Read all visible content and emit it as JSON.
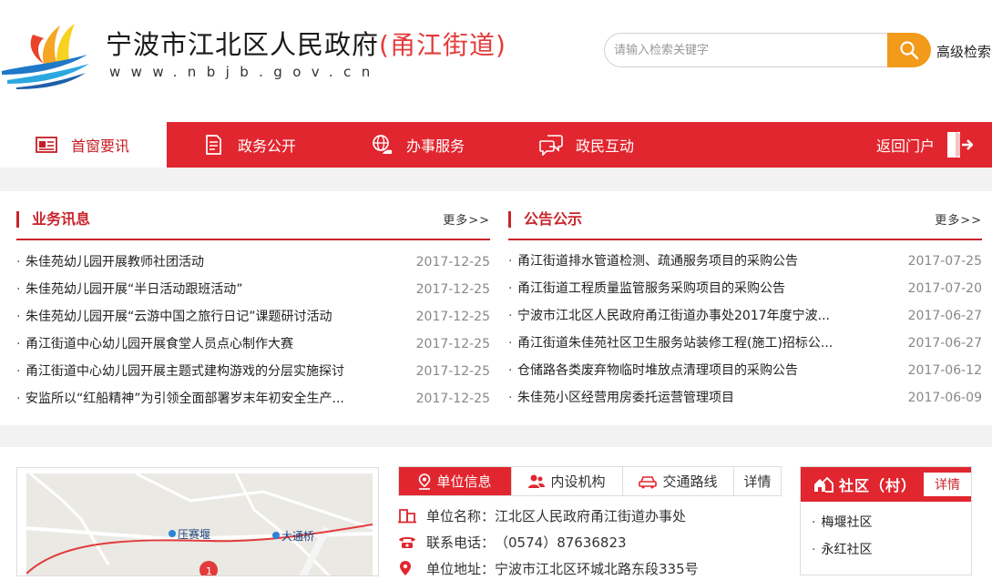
{
  "header": {
    "title_main": "宁波市江北区人民政府",
    "title_sub": "(甬江街道)",
    "url_text": "www.nbjb.gov.cn",
    "search_placeholder": "请输入检索关键字",
    "advanced_search": "高级检索"
  },
  "nav": {
    "items": [
      {
        "label": "首窗要讯",
        "icon": "newspaper-icon"
      },
      {
        "label": "政务公开",
        "icon": "document-icon"
      },
      {
        "label": "办事服务",
        "icon": "globe-hand-icon"
      },
      {
        "label": "政民互动",
        "icon": "chat-bubbles-icon"
      }
    ],
    "back_label": "返回门户"
  },
  "news": {
    "title": "业务讯息",
    "more": "更多>>",
    "items": [
      {
        "text": "朱佳苑幼儿园开展教师社团活动",
        "date": "2017-12-25"
      },
      {
        "text": "朱佳苑幼儿园开展“半日活动跟班活动”",
        "date": "2017-12-25"
      },
      {
        "text": "朱佳苑幼儿园开展“云游中国之旅行日记”课题研讨活动",
        "date": "2017-12-25"
      },
      {
        "text": "甬江街道中心幼儿园开展食堂人员点心制作大赛",
        "date": "2017-12-25"
      },
      {
        "text": "甬江街道中心幼儿园开展主题式建构游戏的分层实施探讨",
        "date": "2017-12-25"
      },
      {
        "text": "安监所以“红船精神”为引领全面部署岁末年初安全生产...",
        "date": "2017-12-25"
      }
    ]
  },
  "notices": {
    "title": "公告公示",
    "more": "更多>>",
    "items": [
      {
        "text": "甬江街道排水管道检测、疏通服务项目的采购公告",
        "date": "2017-07-25"
      },
      {
        "text": "甬江街道工程质量监管服务采购项目的采购公告",
        "date": "2017-07-20"
      },
      {
        "text": "宁波市江北区人民政府甬江街道办事处2017年度宁波...",
        "date": "2017-06-27"
      },
      {
        "text": "甬江街道朱佳苑社区卫生服务站装修工程(施工)招标公...",
        "date": "2017-06-27"
      },
      {
        "text": "仓储路各类废弃物临时堆放点清理项目的采购公告",
        "date": "2017-06-12"
      },
      {
        "text": "朱佳苑小区经营用房委托运营管理项目",
        "date": "2017-06-09"
      }
    ]
  },
  "map": {
    "labels": [
      "压赛堰",
      "大通桥"
    ],
    "marker": "1"
  },
  "info_tabs": {
    "tabs": [
      "单位信息",
      "内设机构",
      "交通路线",
      "详情"
    ],
    "rows": [
      {
        "label": "单位名称：",
        "value": "江北区人民政府甬江街道办事处"
      },
      {
        "label": "联系电话：",
        "value": "（0574）87636823"
      },
      {
        "label": "单位地址：",
        "value": "宁波市江北区环城北路东段335号"
      }
    ]
  },
  "community": {
    "title": "社区（村）",
    "more": "详情",
    "items": [
      "梅堰社区",
      "永红社区"
    ]
  },
  "colors": {
    "brand_red": "#e1262f",
    "title_red": "#c9242b",
    "search_orange": "#f29a19"
  }
}
